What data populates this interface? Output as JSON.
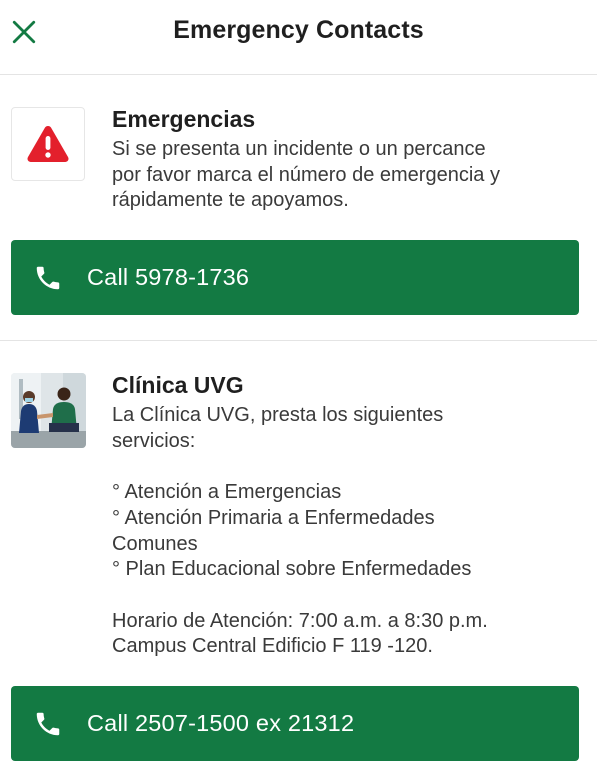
{
  "header": {
    "title": "Emergency Contacts",
    "close_icon": "close-icon"
  },
  "contacts": [
    {
      "title": "Emergencias",
      "description": "Si se presenta un incidente o un percance\npor favor marca el número de emergencia y\nrápidamente te apoyamos.",
      "icon": "warning-icon",
      "call_label": "Call 5978-1736"
    },
    {
      "title": "Clínica UVG",
      "description": "La Clínica UVG, presta los siguientes\nservicios:\n\n° Atención a Emergencias\n° Atención Primaria a Enfermedades\nComunes\n° Plan Educacional sobre Enfermedades\n\nHorario de Atención: 7:00 a.m. a 8:30 p.m.\nCampus Central Edificio F 119 -120.",
      "icon": "clinic-photo",
      "call_label": "Call 2507-1500 ex 21312"
    }
  ],
  "colors": {
    "accent": "#137a43",
    "warning": "#e3202c"
  }
}
